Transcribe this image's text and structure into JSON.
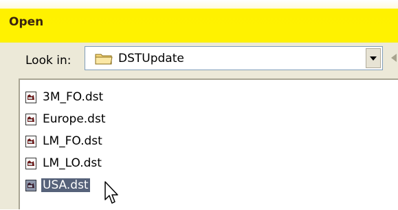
{
  "dialog": {
    "title": "Open"
  },
  "look_in": {
    "label": "Look in:",
    "value": "DSTUpdate",
    "icon": "folder-icon"
  },
  "files": [
    {
      "name": "3M_FO.dst",
      "icon": "dst-file-icon",
      "selected": false
    },
    {
      "name": "Europe.dst",
      "icon": "dst-file-icon",
      "selected": false
    },
    {
      "name": "LM_FO.dst",
      "icon": "dst-file-icon",
      "selected": false
    },
    {
      "name": "LM_LO.dst",
      "icon": "dst-file-icon",
      "selected": false
    },
    {
      "name": "USA.dst",
      "icon": "dst-file-icon",
      "selected": true
    }
  ],
  "colors": {
    "titlebar": "#fff200",
    "panel": "#ece9d8",
    "selection": "#56627a"
  }
}
